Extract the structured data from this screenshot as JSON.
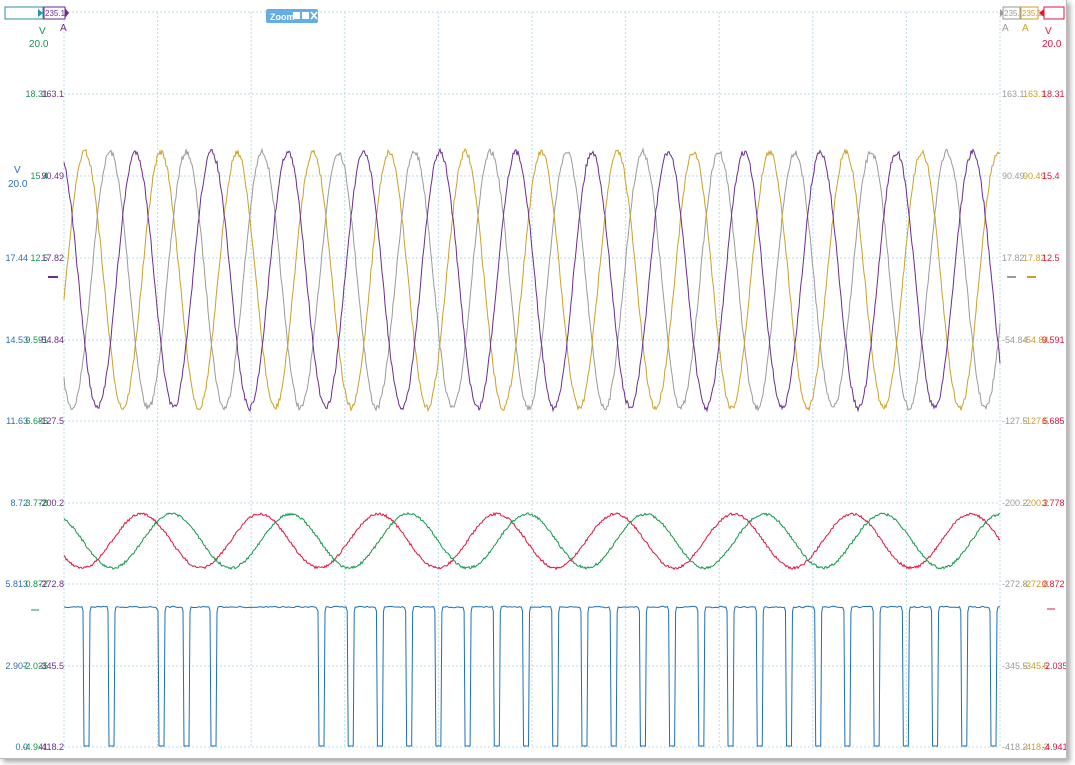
{
  "colors": {
    "grid": "#b9dde8",
    "ch_blue": "#1f6fb5",
    "ch_green": "#14964a",
    "ch_red": "#e0143c",
    "ch_purple": "#6a2d8e",
    "ch_gold": "#c9a12a",
    "ch_gray": "#9a9a9a",
    "tick_blue": "#2f6fb0",
    "zoom_bg": "#64aee6"
  },
  "toolbar": {
    "zoom_label": "Zoom",
    "zoom_icons": [
      "square-icon",
      "square-icon",
      "close-icon"
    ]
  },
  "marker_tags": {
    "top_left_value": "235.1",
    "top_right_values": [
      "235.1",
      "235.1"
    ]
  },
  "channel_units": {
    "left_green": {
      "unit": "V",
      "value": "20.0"
    },
    "left_small": "A",
    "left_blue": {
      "unit": "V",
      "value": "20.0"
    },
    "right_red": {
      "unit": "V",
      "value": "20.0"
    },
    "right_small": [
      "A",
      "A"
    ]
  },
  "axis_ticks": {
    "left": [
      {
        "cols": [
          "",
          "18.31",
          "163.1"
        ]
      },
      {
        "cols": [
          "",
          "15.4",
          "90.49"
        ]
      },
      {
        "cols": [
          "17.44",
          "12.5",
          "17.82"
        ]
      },
      {
        "cols": [
          "14.53",
          "9.591",
          "-54.84"
        ]
      },
      {
        "cols": [
          "11.63",
          "6.685",
          "-127.5"
        ]
      },
      {
        "cols": [
          "8.72",
          "3.778",
          "-200.2"
        ]
      },
      {
        "cols": [
          "5.813",
          "0.872",
          "-272.8"
        ]
      },
      {
        "cols": [
          "2.907",
          "-2.035",
          "-345.5"
        ]
      },
      {
        "cols": [
          "0.0",
          "-4.941",
          "-418.2"
        ]
      }
    ],
    "right": [
      {
        "cols": [
          "163.1",
          "163.1",
          "18.31"
        ]
      },
      {
        "cols": [
          "90.49",
          "90.49",
          "15.4"
        ]
      },
      {
        "cols": [
          "17.82",
          "17.82",
          "12.5"
        ]
      },
      {
        "cols": [
          "-54.84",
          "-54.84",
          "9.591"
        ]
      },
      {
        "cols": [
          "-127.5",
          "-127.5",
          "6.685"
        ]
      },
      {
        "cols": [
          "-200.2",
          "-200.2",
          "3.778"
        ]
      },
      {
        "cols": [
          "-272.8",
          "-272.8",
          "0.872"
        ]
      },
      {
        "cols": [
          "-345.5",
          "-345.5",
          "-2.035"
        ]
      },
      {
        "cols": [
          "-418.2",
          "-418.2",
          "-4.941"
        ]
      }
    ]
  },
  "traces": {
    "upper_group": {
      "channels": [
        "gray",
        "gold",
        "purple"
      ],
      "cycles": 12.3
    },
    "middle_group": {
      "channels": [
        "red",
        "green"
      ],
      "cycles": 7.9
    },
    "pulse_train": {
      "channel": "blue",
      "pulses": 29
    }
  }
}
